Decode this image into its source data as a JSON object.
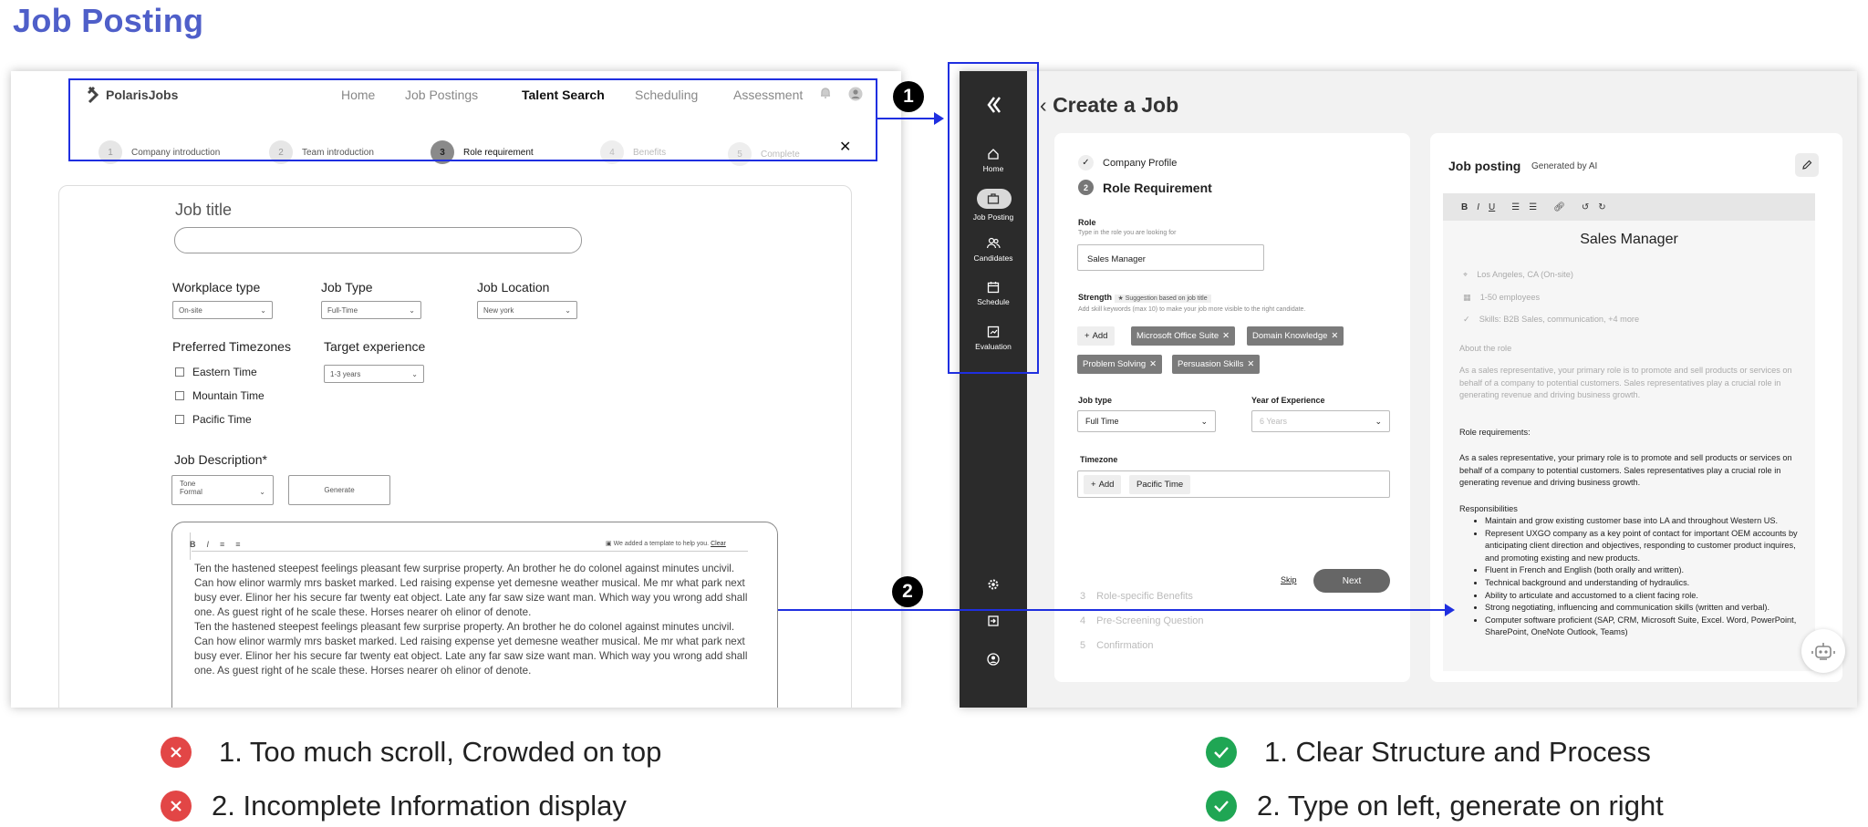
{
  "page": {
    "title": "Job Posting"
  },
  "left": {
    "logo": "PolarisJobs",
    "nav": [
      "Home",
      "Job Postings",
      "Talent Search",
      "Scheduling",
      "Assessment"
    ],
    "active_nav": "Talent Search",
    "steps": [
      {
        "num": "1",
        "label": "Company introduction"
      },
      {
        "num": "2",
        "label": "Team introduction"
      },
      {
        "num": "3",
        "label": "Role requirement"
      },
      {
        "num": "4",
        "label": "Benefits"
      },
      {
        "num": "5",
        "label": "Complete"
      }
    ],
    "close": "✕",
    "job_title_label": "Job title",
    "workplace_type": {
      "label": "Workplace type",
      "value": "On-site"
    },
    "job_type": {
      "label": "Job Type",
      "value": "Full-Time"
    },
    "job_location": {
      "label": "Job Location",
      "value": "New york"
    },
    "timezones": {
      "label": "Preferred Timezones",
      "options": [
        "Eastern Time",
        "Mountain Time",
        "Pacific Time"
      ]
    },
    "target_experience": {
      "label": "Target experience",
      "value": "1-3 years"
    },
    "job_description": {
      "label": "Job Description*",
      "tone_label": "Tone",
      "tone_value": "Formal",
      "generate": "Generate"
    },
    "editor": {
      "tools": [
        "B",
        "I",
        "≡",
        "≡"
      ],
      "template_note": "We added a template to help you.",
      "clear": "Clear",
      "text1": "Ten the hastened steepest feelings pleasant few surprise property. An brother he do colonel against minutes uncivil. Can how elinor warmly mrs basket marked. Led raising expense yet demesne weather musical. Me mr what park next busy ever. Elinor her his secure far twenty eat object. Late any far saw size want man. Which way you wrong add shall one. As guest right of he scale these. Horses nearer oh elinor of denote.",
      "text2": "Ten the hastened steepest feelings pleasant few surprise property. An brother he do colonel against minutes uncivil. Can how elinor warmly mrs basket marked. Led raising expense yet demesne weather musical. Me mr what park next busy ever. Elinor her his secure far twenty eat object. Late any far saw size want man. Which way you wrong add shall one. As guest right of he scale these. Horses nearer oh elinor of denote."
    }
  },
  "right": {
    "sidebar": [
      {
        "label": "Home",
        "icon": "home-icon"
      },
      {
        "label": "Job Posting",
        "icon": "briefcase-icon"
      },
      {
        "label": "Candidates",
        "icon": "users-icon"
      },
      {
        "label": "Schedule",
        "icon": "calendar-icon"
      },
      {
        "label": "Evaluation",
        "icon": "chart-icon"
      }
    ],
    "title": "Create a Job",
    "company_profile": "Company Profile",
    "role_requirement": {
      "num": "2",
      "label": "Role Requirement"
    },
    "role": {
      "label": "Role",
      "hint": "Type in the role you are looking for",
      "value": "Sales Manager"
    },
    "strength": {
      "label": "Strength",
      "suggest": "★ Suggestion based on job title",
      "hint": "Add skill keywords (max 10) to make your job more visible to the right candidate.",
      "add": "Add",
      "tags": [
        "Microsoft Office Suite",
        "Domain Knowledge",
        "Problem Solving",
        "Persuasion Skills"
      ]
    },
    "job_type": {
      "label": "Job type",
      "value": "Full Time"
    },
    "experience": {
      "label": "Year of Experience",
      "value": "6 Years"
    },
    "timezone": {
      "label": "Timezone",
      "add": "Add",
      "tag": "Pacific Time"
    },
    "skip": "Skip",
    "next": "Next",
    "future_steps": [
      {
        "num": "3",
        "label": "Role-specific Benefits"
      },
      {
        "num": "4",
        "label": "Pre-Screening Question"
      },
      {
        "num": "5",
        "label": "Confirmation"
      }
    ],
    "posting": {
      "title": "Job posting",
      "generated": "Generated by AI",
      "job": "Sales Manager",
      "location": "Los Angeles, CA (On-site)",
      "employees": "1-50 employees",
      "skills": "Skills: B2B Sales, communication, +4 more",
      "about_label": "About the role",
      "about_text": "As a sales representative, your primary role is to promote and sell products or services on behalf of a company to potential customers. Sales representatives play a crucial role in generating revenue and driving business growth.",
      "req_label": "Role requirements:",
      "req_text": "As a sales representative, your primary role is to promote and sell products or services on behalf of a company to potential customers. Sales representatives play a crucial role in generating revenue and driving business growth.",
      "resp_label": "Responsibilities",
      "resp": [
        "Maintain and grow existing customer base into LA and throughout Western US.",
        "Represent UXGO company as a key point of contact for important OEM accounts by anticipating client direction and objectives, responding to customer product inquires, and promoting existing and new products.",
        "Fluent in French and English (both orally and written).",
        "Technical background and understanding of hydraulics.",
        "Ability to articulate and accustomed to a client facing role.",
        "Strong negotiating, influencing and communication skills (written and verbal).",
        "Computer software proficient (SAP, CRM, Microsoft Suite, Excel. Word, PowerPoint, SharePoint, OneNote Outlook, Teams)"
      ]
    }
  },
  "annotations": {
    "one": "1",
    "two": "2"
  },
  "verdicts": {
    "bad": [
      "1. Too much scroll, Crowded on top",
      "2. Incomplete Information display"
    ],
    "good": [
      "1. Clear Structure and Process",
      "2. Type on left, generate on right"
    ]
  },
  "colors": {
    "accent": "#4f5fc9",
    "highlight": "#1f2fe0",
    "bad": "#e24646",
    "good": "#1fa654",
    "sidebar": "#2b2b2b"
  }
}
